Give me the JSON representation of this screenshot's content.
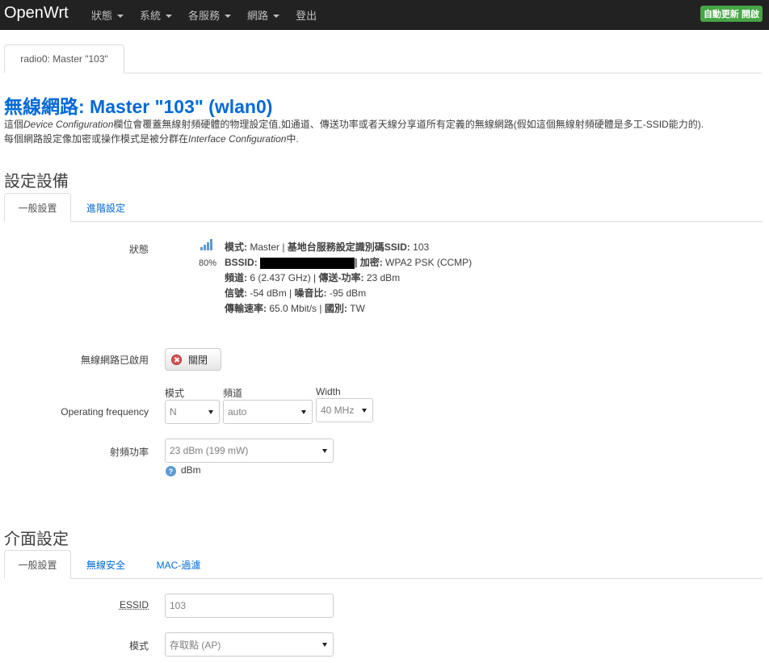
{
  "topbar": {
    "brand": "OpenWrt",
    "menu": [
      {
        "label": "狀態"
      },
      {
        "label": "系統"
      },
      {
        "label": "各服務"
      },
      {
        "label": "網路"
      },
      {
        "label": "登出"
      }
    ],
    "auto_refresh": "自動更新 開啟"
  },
  "radio_tab": "radio0: Master \"103\"",
  "page_title": "無線網路: Master \"103\" (wlan0)",
  "description": {
    "p1": "這個",
    "device_config": "Device Configuration",
    "p2": "欄位會覆蓋無線射頻硬體的物理設定值,如通道、傳送功率或者天線分享道所有定義的無線網路(假如這個無線射頻硬體是多工-SSID能力的).",
    "p3": "每個網路設定像加密或操作模式是被分群在",
    "iface_config": "Interface Configuration",
    "p4": "中."
  },
  "device_section": {
    "title": "設定設備",
    "tabs": [
      {
        "label": "一般設置"
      },
      {
        "label": "進階設定"
      }
    ],
    "status_label": "狀態",
    "signal_percent": "80%",
    "status": {
      "mode_key": "模式:",
      "mode_val": " Master | ",
      "ssid_key": "基地台服務設定識別碼SSID:",
      "ssid_val": " 103",
      "bssid_key": "BSSID:",
      "enc_key": "| 加密:",
      "enc_val": " WPA2 PSK (CCMP)",
      "channel_key": "頻道:",
      "channel_val": " 6 (2.437 GHz) | ",
      "txpower_key": "傳送-功率:",
      "txpower_val": " 23 dBm",
      "signal_key": "信號:",
      "signal_val": " -54 dBm | ",
      "noise_key": "噪音比:",
      "noise_val": " -95 dBm",
      "bitrate_key": "傳輸速率:",
      "bitrate_val": " 65.0 Mbit/s | ",
      "country_key": "國別:",
      "country_val": " TW"
    },
    "wireless_enabled_label": "無線網路已啟用",
    "disable_button": "關閉",
    "freq_label": "Operating frequency",
    "freq": {
      "mode_label": "模式",
      "mode_value": "N",
      "channel_label": "頻道",
      "channel_value": "auto",
      "width_label": "Width",
      "width_value": "40 MHz"
    },
    "txpower_label": "射頻功率",
    "txpower_value": "23 dBm (199 mW)",
    "txpower_help": "dBm"
  },
  "iface_section": {
    "title": "介面設定",
    "tabs": [
      {
        "label": "一般設置"
      },
      {
        "label": "無線安全"
      },
      {
        "label": "MAC-過濾"
      }
    ],
    "essid_label": "ESSID",
    "essid_value": "103",
    "mode_label": "模式",
    "mode_value": "存取點 (AP)"
  }
}
